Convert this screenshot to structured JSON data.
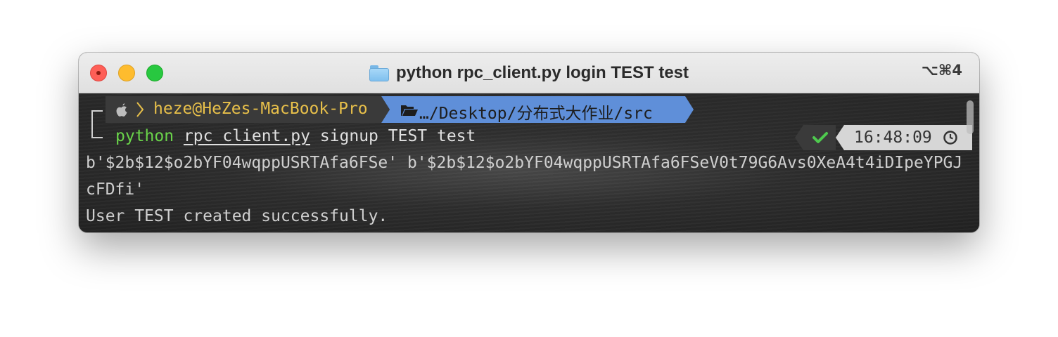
{
  "window": {
    "title": "python rpc_client.py login TEST test",
    "shortcut": "⌥⌘4"
  },
  "prompt": {
    "user_host": "heze@HeZes-MacBook-Pro",
    "path": "…/Desktop/分布式大作业/src",
    "icons": [
      "apple-icon",
      "chevron-right-icon",
      "folder-open-icon"
    ]
  },
  "command": {
    "program": "python",
    "file": "rpc_client.py",
    "args": " signup TEST test"
  },
  "status": {
    "icon": "check-icon",
    "time": "16:48:09",
    "time_icon": "clock-icon"
  },
  "output": [
    "b'$2b$12$o2bYF04wqppUSRTAfa6FSe' b'$2b$12$o2bYF04wqppUSRTAfa6FSeV0t79G6Avs0XeA4t4iDIpeYPGJ",
    "cFDfi'",
    "User TEST created successfully."
  ],
  "colors": {
    "user_host": "#e8c04a",
    "path_segment": "#5f8fd9",
    "command": "#6ad44a",
    "success": "#4ec94e"
  }
}
